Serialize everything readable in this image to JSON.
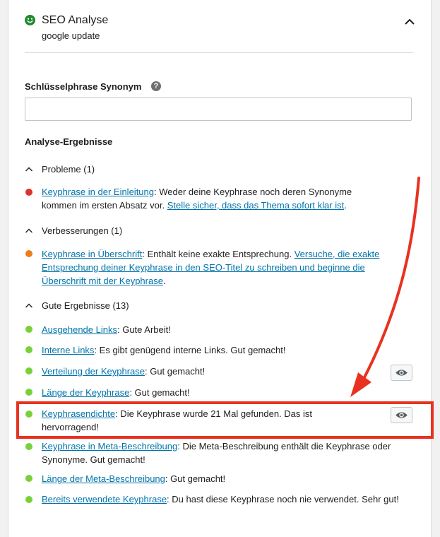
{
  "header": {
    "title": "SEO Analyse",
    "keyphrase": "google update"
  },
  "synonym": {
    "label": "Schlüsselphrase Synonym",
    "help": "?",
    "value": "",
    "placeholder": ""
  },
  "results": {
    "heading": "Analyse-Ergebnisse",
    "problems": {
      "label": "Probleme (1)",
      "items": [
        {
          "link": "Keyphrase in der Einleitung",
          "text1": ": Weder deine Keyphrase noch deren Synonyme kommen im ersten Absatz vor. ",
          "link2": "Stelle sicher, dass das Thema sofort klar ist",
          "text2": "."
        }
      ]
    },
    "improvements": {
      "label": "Verbesserungen (1)",
      "items": [
        {
          "link": "Keyphrase in Überschrift",
          "text1": ": Enthält keine exakte Entsprechung. ",
          "link2": "Versuche, die exakte Entsprechung deiner Keyphrase in den SEO-Titel zu schreiben und beginne die Überschrift mit der Keyphrase",
          "text2": "."
        }
      ]
    },
    "good": {
      "label": "Gute Ergebnisse (13)",
      "items": [
        {
          "link": "Ausgehende Links",
          "text": ": Gute Arbeit!"
        },
        {
          "link": "Interne Links",
          "text": ": Es gibt genügend interne Links. Gut gemacht!"
        },
        {
          "link": "Verteilung der Keyphrase",
          "text": ": Gut gemacht!"
        },
        {
          "link": "Länge der Keyphrase",
          "text": ": Gut gemacht!"
        },
        {
          "link": "Keyphrasendichte",
          "text": ": Die Keyphrase wurde 21 Mal gefunden. Das ist hervorragend!"
        },
        {
          "link": "Keyphrase in Meta-Beschreibung",
          "text": ": Die Meta-Beschreibung enthält die Keyphrase oder Synonyme. Gut gemacht!"
        },
        {
          "link": "Länge der Meta-Beschreibung",
          "text": ": Gut gemacht!"
        },
        {
          "link": "Bereits verwendete Keyphrase",
          "text": ": Du hast diese Keyphrase noch nie verwendet. Sehr gut!"
        }
      ]
    }
  },
  "colors": {
    "good": "#7ad03a",
    "ok": "#ee7c1b",
    "bad": "#dc3232",
    "link": "#0073aa",
    "annotation": "#e8321f"
  },
  "icons": {
    "status": "smiley-icon",
    "collapse": "chevron-up-icon",
    "group_toggle": "chevron-up-icon",
    "marker": "eye-icon"
  }
}
